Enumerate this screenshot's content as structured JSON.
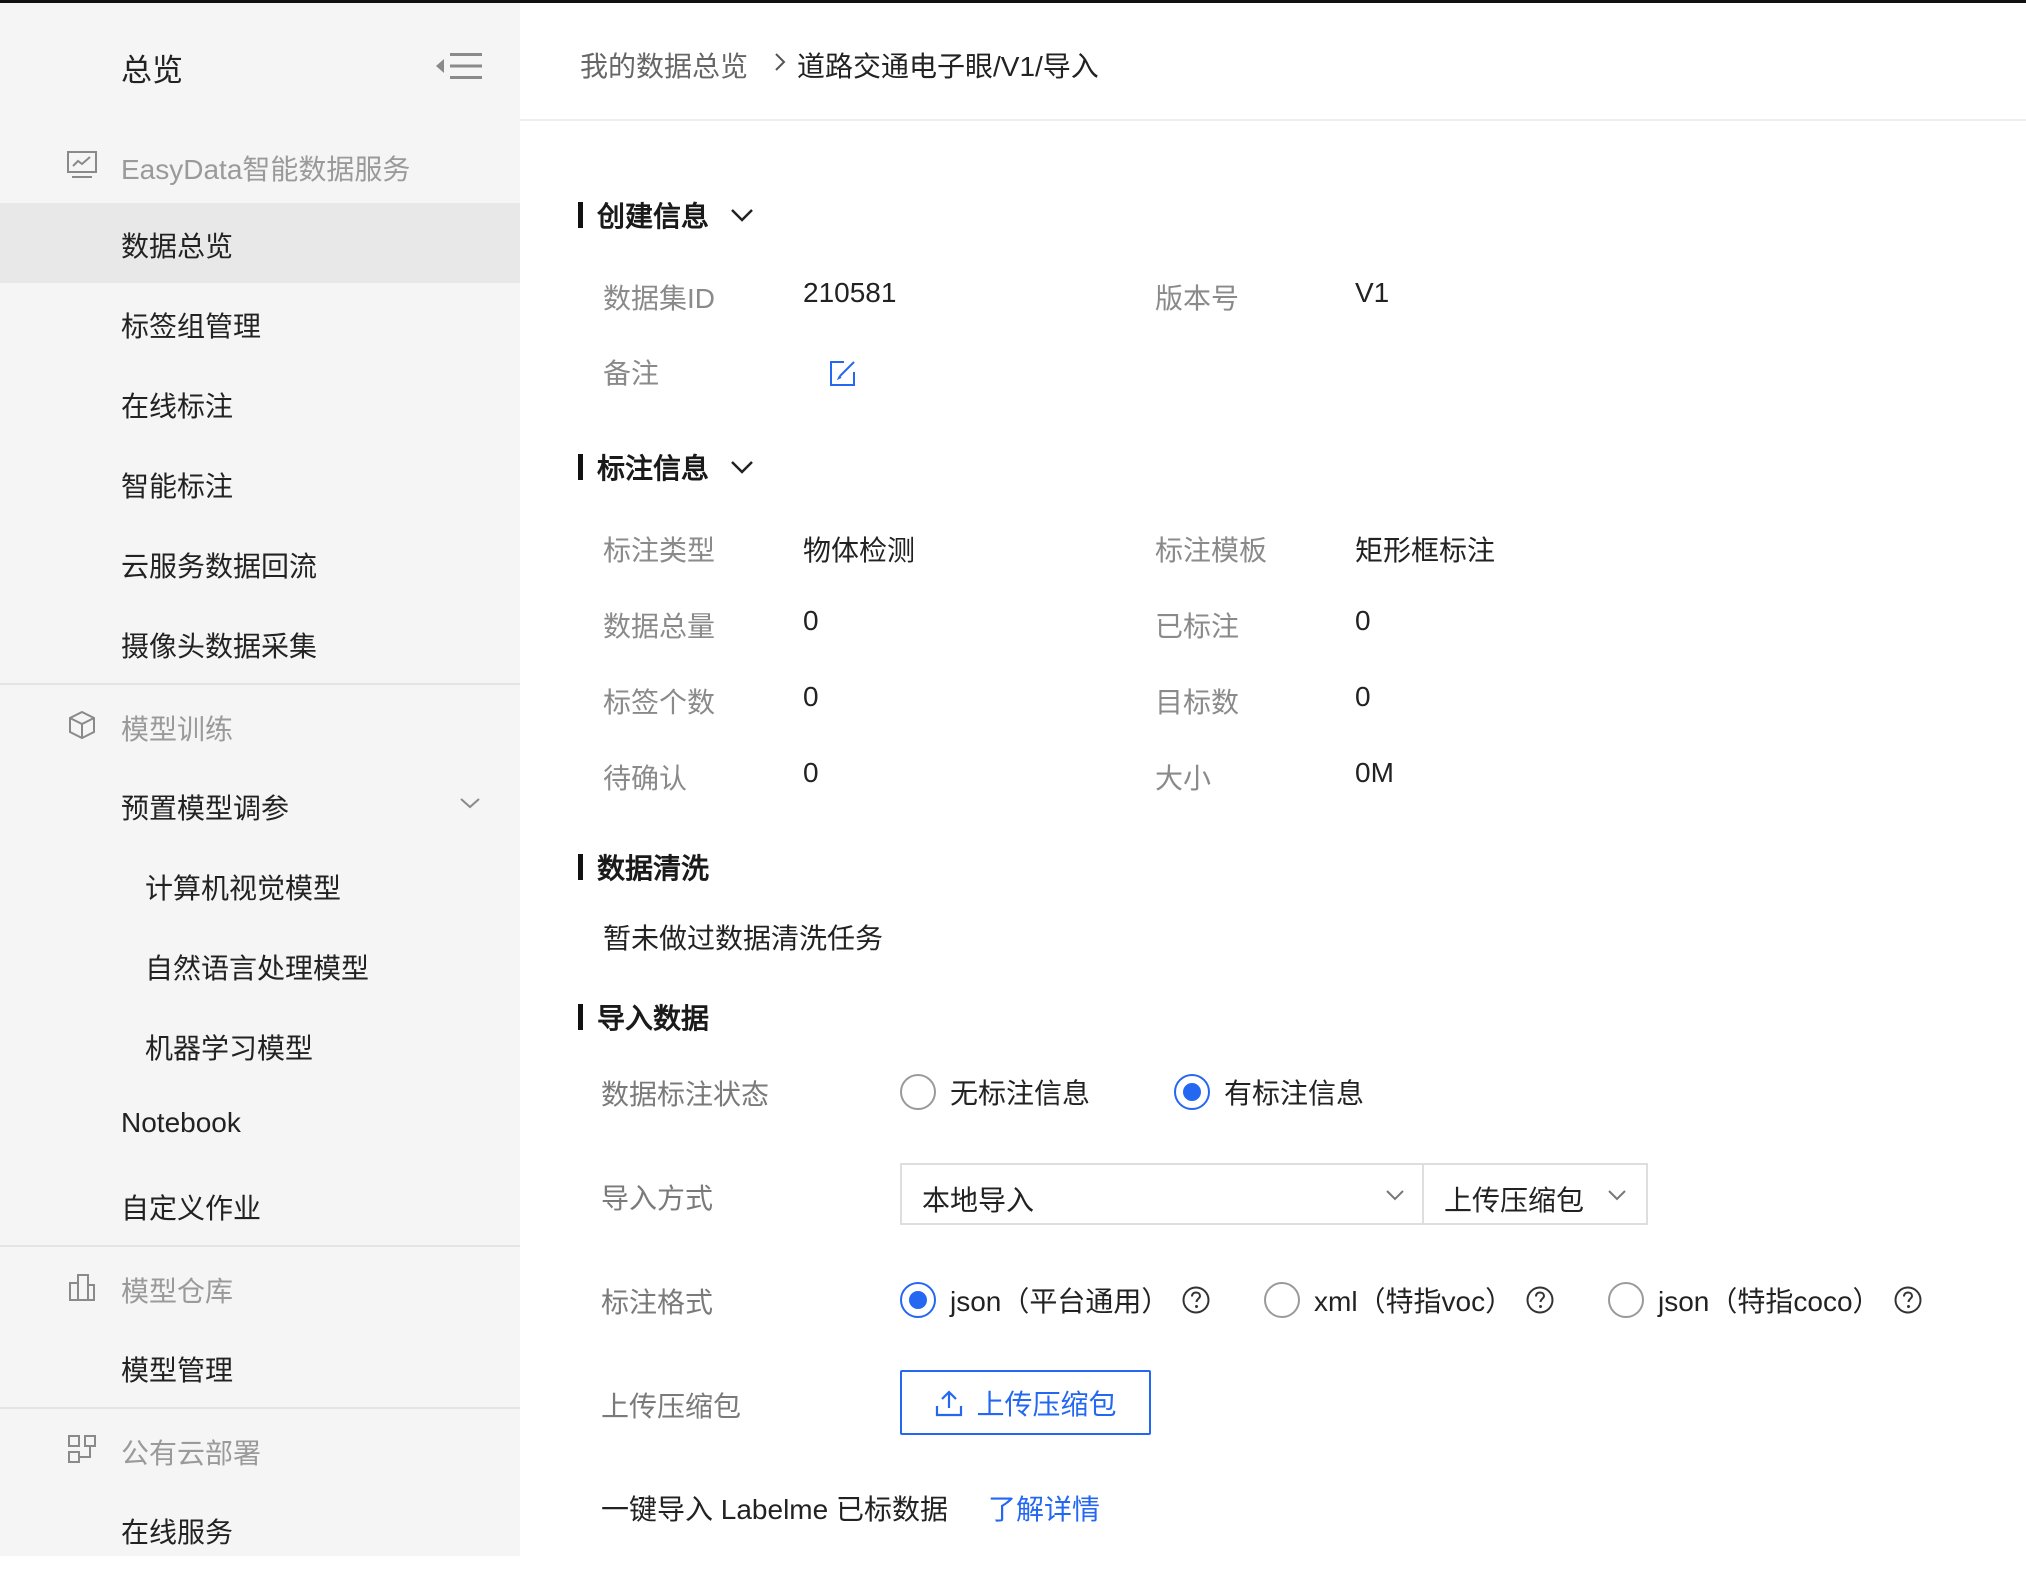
{
  "sidebar": {
    "title": "总览",
    "groups": [
      {
        "label": "EasyData智能数据服务",
        "icon": "chart-monitor-icon"
      },
      {
        "label": "模型训练",
        "icon": "cube-icon"
      },
      {
        "label": "模型仓库",
        "icon": "building-icon"
      },
      {
        "label": "公有云部署",
        "icon": "deploy-icon"
      }
    ],
    "items": {
      "data_overview": "数据总览",
      "label_group": "标签组管理",
      "online_label": "在线标注",
      "smart_label": "智能标注",
      "cloud_backflow": "云服务数据回流",
      "camera_collect": "摄像头数据采集",
      "preset_tuning": "预置模型调参",
      "cv_model": "计算机视觉模型",
      "nlp_model": "自然语言处理模型",
      "ml_model": "机器学习模型",
      "notebook": "Notebook",
      "custom_job": "自定义作业",
      "model_manage": "模型管理",
      "online_service": "在线服务"
    },
    "active_item": "数据总览"
  },
  "breadcrumb": {
    "parent": "我的数据总览",
    "current": "道路交通电子眼/V1/导入"
  },
  "create_info": {
    "title": "创建信息",
    "dataset_id_label": "数据集ID",
    "dataset_id": "210581",
    "version_label": "版本号",
    "version": "V1",
    "note_label": "备注"
  },
  "label_info": {
    "title": "标注信息",
    "type_label": "标注类型",
    "type": "物体检测",
    "template_label": "标注模板",
    "template": "矩形框标注",
    "total_label": "数据总量",
    "total": "0",
    "labeled_label": "已标注",
    "labeled": "0",
    "tag_count_label": "标签个数",
    "tag_count": "0",
    "target_count_label": "目标数",
    "target_count": "0",
    "pending_label": "待确认",
    "pending": "0",
    "size_label": "大小",
    "size": "0M"
  },
  "cleaning": {
    "title": "数据清洗",
    "text": "暂未做过数据清洗任务"
  },
  "import": {
    "title": "导入数据",
    "status_label": "数据标注状态",
    "status_options": [
      "无标注信息",
      "有标注信息"
    ],
    "status_selected": "有标注信息",
    "method_label": "导入方式",
    "method_value": "本地导入",
    "method_sub_value": "上传压缩包",
    "format_label": "标注格式",
    "format_options": [
      "json（平台通用）",
      "xml（特指voc）",
      "json（特指coco）"
    ],
    "format_selected": "json（平台通用）",
    "upload_label": "上传压缩包",
    "upload_button": "上传压缩包",
    "labelme_text": "一键导入 Labelme 已标数据",
    "learn_more": "了解详情"
  },
  "colors": {
    "accent": "#2468f2",
    "sidebar_bg": "#f5f5f5",
    "active_bg": "#e8e8e8"
  }
}
